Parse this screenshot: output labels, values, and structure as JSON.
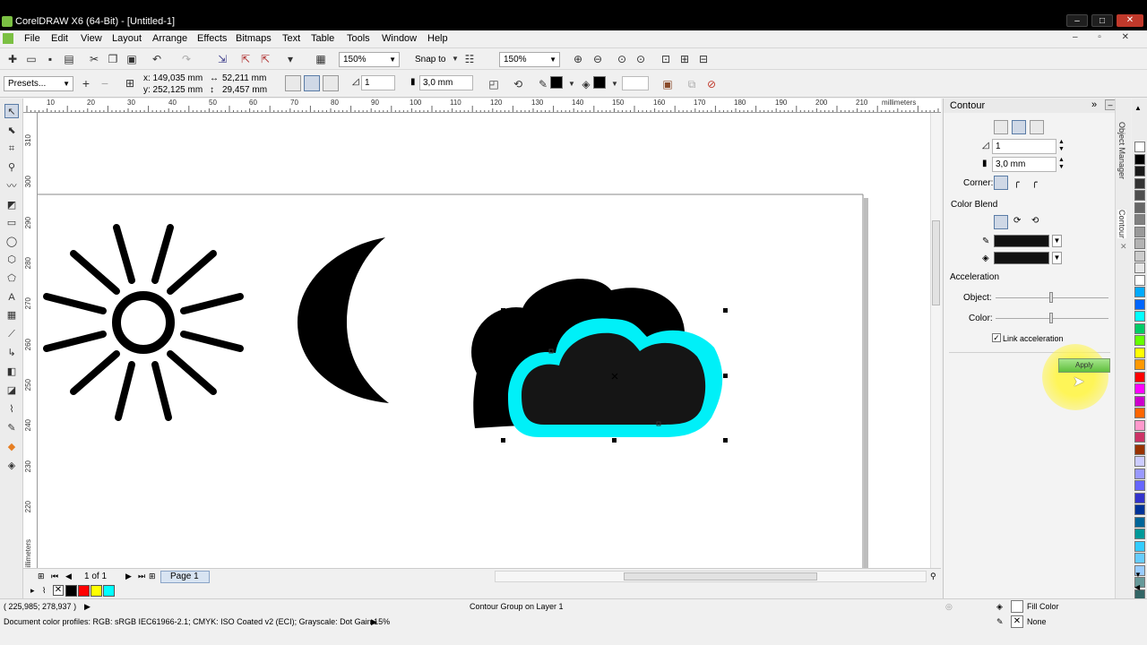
{
  "window": {
    "title": "CorelDRAW X6 (64-Bit) - [Untitled-1]"
  },
  "menu": [
    "File",
    "Edit",
    "View",
    "Layout",
    "Arrange",
    "Effects",
    "Bitmaps",
    "Text",
    "Table",
    "Tools",
    "Window",
    "Help"
  ],
  "standard_toolbar": {
    "zoom1": "150%",
    "snap_to": "Snap to",
    "zoom2": "150%"
  },
  "property_bar": {
    "presets": "Presets...",
    "x": "x:  149,035 mm",
    "y": "y:  252,125 mm",
    "width": "52,211 mm",
    "height": "29,457 mm",
    "steps": "1",
    "offset": "3,0 mm"
  },
  "ruler": {
    "top": [
      "10",
      "20",
      "30",
      "40",
      "50",
      "60",
      "70",
      "80",
      "90",
      "100",
      "110",
      "120",
      "130",
      "140",
      "150",
      "160",
      "170",
      "180",
      "190",
      "200",
      "210"
    ],
    "unit": "millimeters",
    "left": [
      "310",
      "300",
      "290",
      "280",
      "270",
      "260",
      "250",
      "240",
      "230",
      "220"
    ]
  },
  "page_nav": {
    "count": "1 of 1",
    "page_tab": "Page 1"
  },
  "docker": {
    "title": "Contour",
    "steps": "1",
    "offset": "3,0 mm",
    "corner_label": "Corner:",
    "color_blend_label": "Color Blend",
    "acceleration_label": "Acceleration",
    "object_label": "Object:",
    "color_label": "Color:",
    "link_acceleration": "Link acceleration",
    "apply": "Apply",
    "outline_color": "#111111",
    "fill_color": "#111111"
  },
  "docker_tabs": [
    "Object Manager",
    "Contour"
  ],
  "palette_colors": [
    "#ffffff",
    "#000000",
    "#1a1a1a",
    "#333333",
    "#4d4d4d",
    "#666666",
    "#808080",
    "#999999",
    "#b3b3b3",
    "#cccccc",
    "#e6e6e6",
    "#ffffff",
    "#00aaff",
    "#0066ff",
    "#00ffff",
    "#00cc66",
    "#66ff00",
    "#ffff00",
    "#ff9900",
    "#ff0000",
    "#ff00ff",
    "#cc00cc",
    "#ff6600",
    "#ff99cc",
    "#cc3366",
    "#993300",
    "#ccccff",
    "#9999ff",
    "#6666ff",
    "#3333cc",
    "#003399",
    "#006699",
    "#009999",
    "#33ccff",
    "#66ccff",
    "#99ccff",
    "#669999",
    "#336666"
  ],
  "bottom_swatches": [
    "#000000",
    "#ff0000",
    "#ffff00",
    "#00ffff"
  ],
  "status": {
    "coords": "( 225,985; 278,937 )",
    "selection": "Contour Group on Layer 1",
    "fill_label": "Fill Color",
    "outline_label": "None",
    "profiles": "Document color profiles: RGB: sRGB IEC61966-2.1; CMYK: ISO Coated v2 (ECI); Grayscale: Dot Gain 15%"
  },
  "colors": {
    "contour": "#00f0f8",
    "shape": "#000000",
    "cloud_inner": "#151515"
  }
}
